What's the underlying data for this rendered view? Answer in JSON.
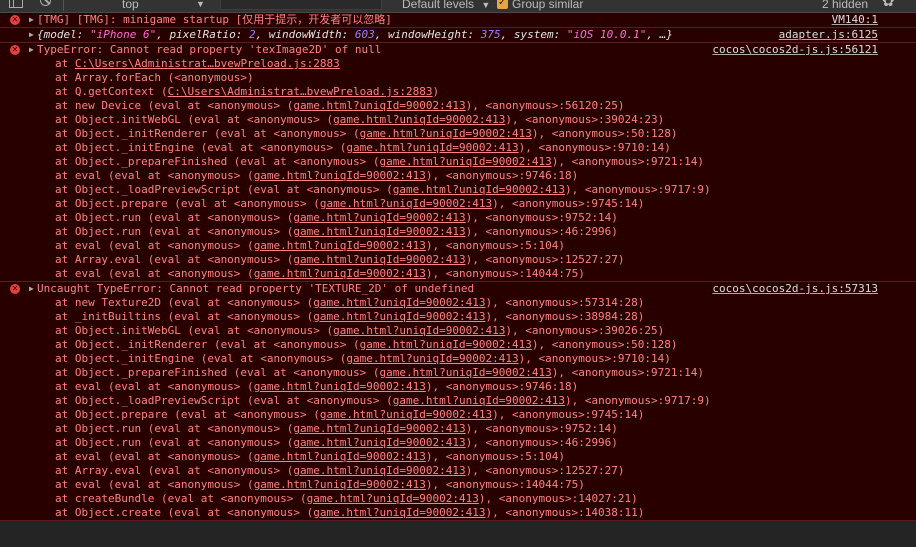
{
  "toolbar": {
    "context": "top",
    "levels": "Default levels",
    "group_similar": "Group similar",
    "hidden_count": "2 hidden"
  },
  "messages": [
    {
      "type": "error",
      "text": "[TMG] [TMG]: minigame startup [仅用于提示，开发者可以忽略]",
      "source": "VM140:1"
    },
    {
      "type": "object",
      "source": "adapter.js:6125",
      "parts": [
        {
          "k": "{model: ",
          "v": "\"iPhone 6\"",
          "vt": "str"
        },
        {
          "k": ", pixelRatio: ",
          "v": "2",
          "vt": "num"
        },
        {
          "k": ", windowWidth: ",
          "v": "603",
          "vt": "num"
        },
        {
          "k": ", windowHeight: ",
          "v": "375",
          "vt": "num"
        },
        {
          "k": ", system: ",
          "v": "\"iOS 10.0.1\"",
          "vt": "str"
        },
        {
          "k": ", …}",
          "v": "",
          "vt": ""
        }
      ]
    },
    {
      "type": "error",
      "text": "TypeError: Cannot read property 'texImage2D' of null",
      "source": "cocos\\cocos2d-js.js:56121",
      "stack": [
        {
          "pre": "at ",
          "link": "C:\\Users\\Administrat…bvewPreload.js:2883",
          "post": ""
        },
        {
          "pre": "at Array.forEach (<anonymous>)",
          "link": "",
          "post": ""
        },
        {
          "pre": "at Q.getContext (",
          "link": "C:\\Users\\Administrat…bvewPreload.js:2883",
          "post": ")"
        },
        {
          "pre": "at new Device (eval at <anonymous> (",
          "link": "game.html?uniqId=90002:413",
          "post": "), <anonymous>:56120:25)"
        },
        {
          "pre": "at Object.initWebGL (eval at <anonymous> (",
          "link": "game.html?uniqId=90002:413",
          "post": "), <anonymous>:39024:23)"
        },
        {
          "pre": "at Object._initRenderer (eval at <anonymous> (",
          "link": "game.html?uniqId=90002:413",
          "post": "), <anonymous>:50:128)"
        },
        {
          "pre": "at Object._initEngine (eval at <anonymous> (",
          "link": "game.html?uniqId=90002:413",
          "post": "), <anonymous>:9710:14)"
        },
        {
          "pre": "at Object._prepareFinished (eval at <anonymous> (",
          "link": "game.html?uniqId=90002:413",
          "post": "), <anonymous>:9721:14)"
        },
        {
          "pre": "at eval (eval at <anonymous> (",
          "link": "game.html?uniqId=90002:413",
          "post": "), <anonymous>:9746:18)"
        },
        {
          "pre": "at Object._loadPreviewScript (eval at <anonymous> (",
          "link": "game.html?uniqId=90002:413",
          "post": "), <anonymous>:9717:9)"
        },
        {
          "pre": "at Object.prepare (eval at <anonymous> (",
          "link": "game.html?uniqId=90002:413",
          "post": "), <anonymous>:9745:14)"
        },
        {
          "pre": "at Object.run (eval at <anonymous> (",
          "link": "game.html?uniqId=90002:413",
          "post": "), <anonymous>:9752:14)"
        },
        {
          "pre": "at Object.run (eval at <anonymous> (",
          "link": "game.html?uniqId=90002:413",
          "post": "), <anonymous>:46:2996)"
        },
        {
          "pre": "at eval (eval at <anonymous> (",
          "link": "game.html?uniqId=90002:413",
          "post": "), <anonymous>:5:104)"
        },
        {
          "pre": "at Array.eval (eval at <anonymous> (",
          "link": "game.html?uniqId=90002:413",
          "post": "), <anonymous>:12527:27)"
        },
        {
          "pre": "at eval (eval at <anonymous> (",
          "link": "game.html?uniqId=90002:413",
          "post": "), <anonymous>:14044:75)"
        }
      ]
    },
    {
      "type": "error",
      "text": "Uncaught TypeError: Cannot read property 'TEXTURE_2D' of undefined",
      "source": "cocos\\cocos2d-js.js:57313",
      "stack": [
        {
          "pre": "at new Texture2D (eval at <anonymous> (",
          "link": "game.html?uniqId=90002:413",
          "post": "), <anonymous>:57314:28)"
        },
        {
          "pre": "at _initBuiltins (eval at <anonymous> (",
          "link": "game.html?uniqId=90002:413",
          "post": "), <anonymous>:38984:28)"
        },
        {
          "pre": "at Object.initWebGL (eval at <anonymous> (",
          "link": "game.html?uniqId=90002:413",
          "post": "), <anonymous>:39026:25)"
        },
        {
          "pre": "at Object._initRenderer (eval at <anonymous> (",
          "link": "game.html?uniqId=90002:413",
          "post": "), <anonymous>:50:128)"
        },
        {
          "pre": "at Object._initEngine (eval at <anonymous> (",
          "link": "game.html?uniqId=90002:413",
          "post": "), <anonymous>:9710:14)"
        },
        {
          "pre": "at Object._prepareFinished (eval at <anonymous> (",
          "link": "game.html?uniqId=90002:413",
          "post": "), <anonymous>:9721:14)"
        },
        {
          "pre": "at eval (eval at <anonymous> (",
          "link": "game.html?uniqId=90002:413",
          "post": "), <anonymous>:9746:18)"
        },
        {
          "pre": "at Object._loadPreviewScript (eval at <anonymous> (",
          "link": "game.html?uniqId=90002:413",
          "post": "), <anonymous>:9717:9)"
        },
        {
          "pre": "at Object.prepare (eval at <anonymous> (",
          "link": "game.html?uniqId=90002:413",
          "post": "), <anonymous>:9745:14)"
        },
        {
          "pre": "at Object.run (eval at <anonymous> (",
          "link": "game.html?uniqId=90002:413",
          "post": "), <anonymous>:9752:14)"
        },
        {
          "pre": "at Object.run (eval at <anonymous> (",
          "link": "game.html?uniqId=90002:413",
          "post": "), <anonymous>:46:2996)"
        },
        {
          "pre": "at eval (eval at <anonymous> (",
          "link": "game.html?uniqId=90002:413",
          "post": "), <anonymous>:5:104)"
        },
        {
          "pre": "at Array.eval (eval at <anonymous> (",
          "link": "game.html?uniqId=90002:413",
          "post": "), <anonymous>:12527:27)"
        },
        {
          "pre": "at eval (eval at <anonymous> (",
          "link": "game.html?uniqId=90002:413",
          "post": "), <anonymous>:14044:75)"
        },
        {
          "pre": "at createBundle (eval at <anonymous> (",
          "link": "game.html?uniqId=90002:413",
          "post": "), <anonymous>:14027:21)"
        },
        {
          "pre": "at Object.create (eval at <anonymous> (",
          "link": "game.html?uniqId=90002:413",
          "post": "), <anonymous>:14038:11)"
        }
      ]
    }
  ]
}
